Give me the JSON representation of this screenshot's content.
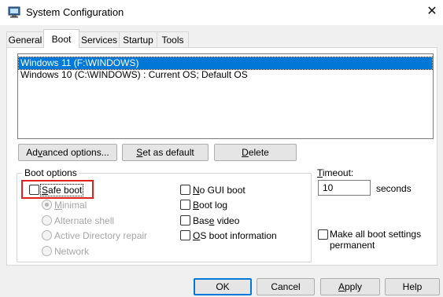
{
  "window": {
    "title": "System Configuration",
    "app_icon": "msconfig-icon",
    "close_icon": "close-icon"
  },
  "tabs": [
    {
      "label": "General",
      "active": false
    },
    {
      "label": "Boot",
      "active": true
    },
    {
      "label": "Services",
      "active": false
    },
    {
      "label": "Startup",
      "active": false
    },
    {
      "label": "Tools",
      "active": false
    }
  ],
  "os_list": [
    {
      "label": "Windows 11 (F:\\WINDOWS)",
      "selected": true
    },
    {
      "label": "Windows 10 (C:\\WINDOWS) : Current OS; Default OS",
      "selected": false
    }
  ],
  "os_buttons": {
    "advanced_pre": "Ad",
    "advanced_key": "v",
    "advanced_post": "anced options...",
    "default_pre": "",
    "default_key": "S",
    "default_post": "et as default",
    "delete_pre": "",
    "delete_key": "D",
    "delete_post": "elete"
  },
  "boot_options": {
    "group_label": "Boot options",
    "safe_boot_key": "S",
    "safe_boot_rest": "afe boot",
    "safe_boot_checked": false,
    "minimal_key": "M",
    "minimal_rest": "inimal",
    "alternate_shell": "Alternate shell",
    "active_directory": "Active Directory repair",
    "network": "Network",
    "no_gui_key": "N",
    "no_gui_rest": "o GUI boot",
    "boot_log_key": "B",
    "boot_log_rest": "oot log",
    "base_video_pre": "Bas",
    "base_video_key": "e",
    "base_video_post": " video",
    "os_boot_key": "O",
    "os_boot_rest": "S boot information"
  },
  "timeout": {
    "label_key": "T",
    "label_rest": "imeout:",
    "value": "10",
    "unit": "seconds"
  },
  "make_permanent": {
    "line1": "Make all boot settings",
    "line2": "permanent",
    "checked": false
  },
  "footer": {
    "ok": "OK",
    "cancel": "Cancel",
    "apply_pre": "",
    "apply_key": "A",
    "apply_post": "pply",
    "help": "Help"
  },
  "colors": {
    "selection": "#0078d7",
    "highlight_box": "#e02020"
  }
}
